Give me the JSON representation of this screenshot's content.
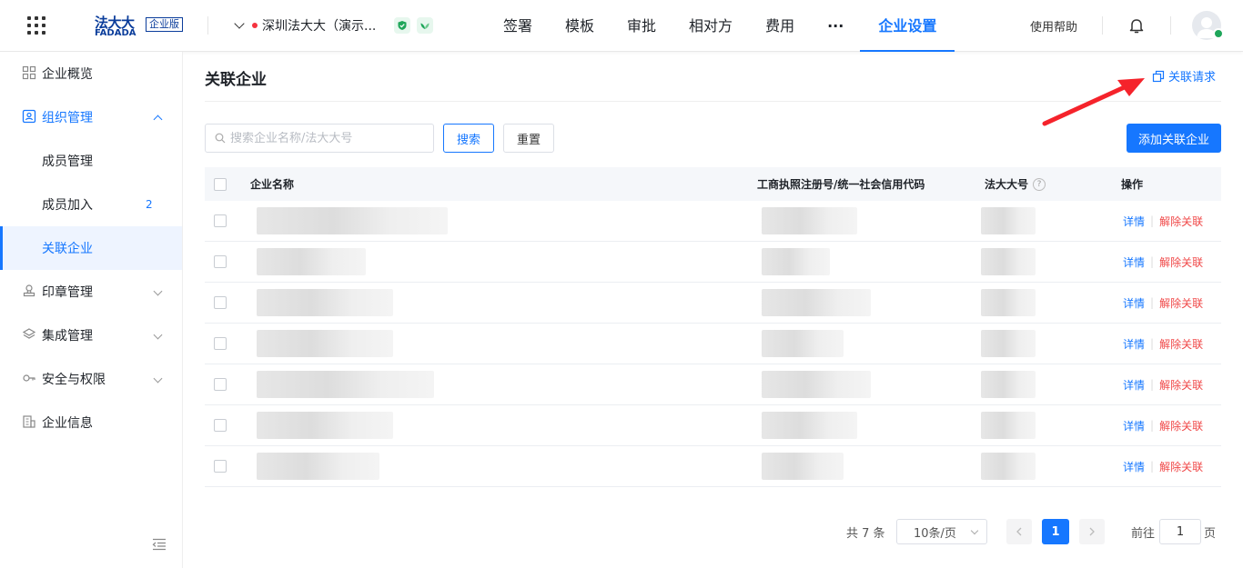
{
  "header": {
    "logo_cn": "法大大",
    "logo_en": "FADADA",
    "logo_badge": "企业版",
    "company_name": "深圳法大大（演示...",
    "nav": [
      "签署",
      "模板",
      "审批",
      "相对方",
      "费用",
      "···",
      "企业设置"
    ],
    "active_nav": "企业设置",
    "help": "使用帮助"
  },
  "sidebar": {
    "items": [
      {
        "label": "企业概览",
        "icon": "overview-icon"
      },
      {
        "label": "组织管理",
        "icon": "org-icon",
        "expanded": true
      },
      {
        "label": "成员管理"
      },
      {
        "label": "成员加入",
        "count": "2"
      },
      {
        "label": "关联企业",
        "active": true
      },
      {
        "label": "印章管理",
        "icon": "seal-icon"
      },
      {
        "label": "集成管理",
        "icon": "layers-icon"
      },
      {
        "label": "安全与权限",
        "icon": "key-icon"
      },
      {
        "label": "企业信息",
        "icon": "building-icon"
      }
    ]
  },
  "main": {
    "title": "关联企业",
    "request_link": "关联请求",
    "search_placeholder": "搜索企业名称/法大大号",
    "search_button": "搜索",
    "reset_button": "重置",
    "add_button": "添加关联企业",
    "columns": [
      "企业名称",
      "工商执照注册号/统一社会信用代码",
      "法大大号",
      "操作"
    ],
    "rows": [
      {
        "detail": "详情",
        "unlink": "解除关联"
      },
      {
        "detail": "详情",
        "unlink": "解除关联"
      },
      {
        "detail": "详情",
        "unlink": "解除关联"
      },
      {
        "detail": "详情",
        "unlink": "解除关联"
      },
      {
        "detail": "详情",
        "unlink": "解除关联"
      },
      {
        "detail": "详情",
        "unlink": "解除关联"
      },
      {
        "detail": "详情",
        "unlink": "解除关联"
      }
    ]
  },
  "pagination": {
    "total": "共 7 条",
    "page_size": "10条/页",
    "current": "1",
    "goto_prefix": "前往",
    "goto_value": "1",
    "goto_suffix": "页"
  },
  "colors": {
    "accent": "#1677ff",
    "danger": "#f04848",
    "annotation_arrow": "#f5232b"
  }
}
